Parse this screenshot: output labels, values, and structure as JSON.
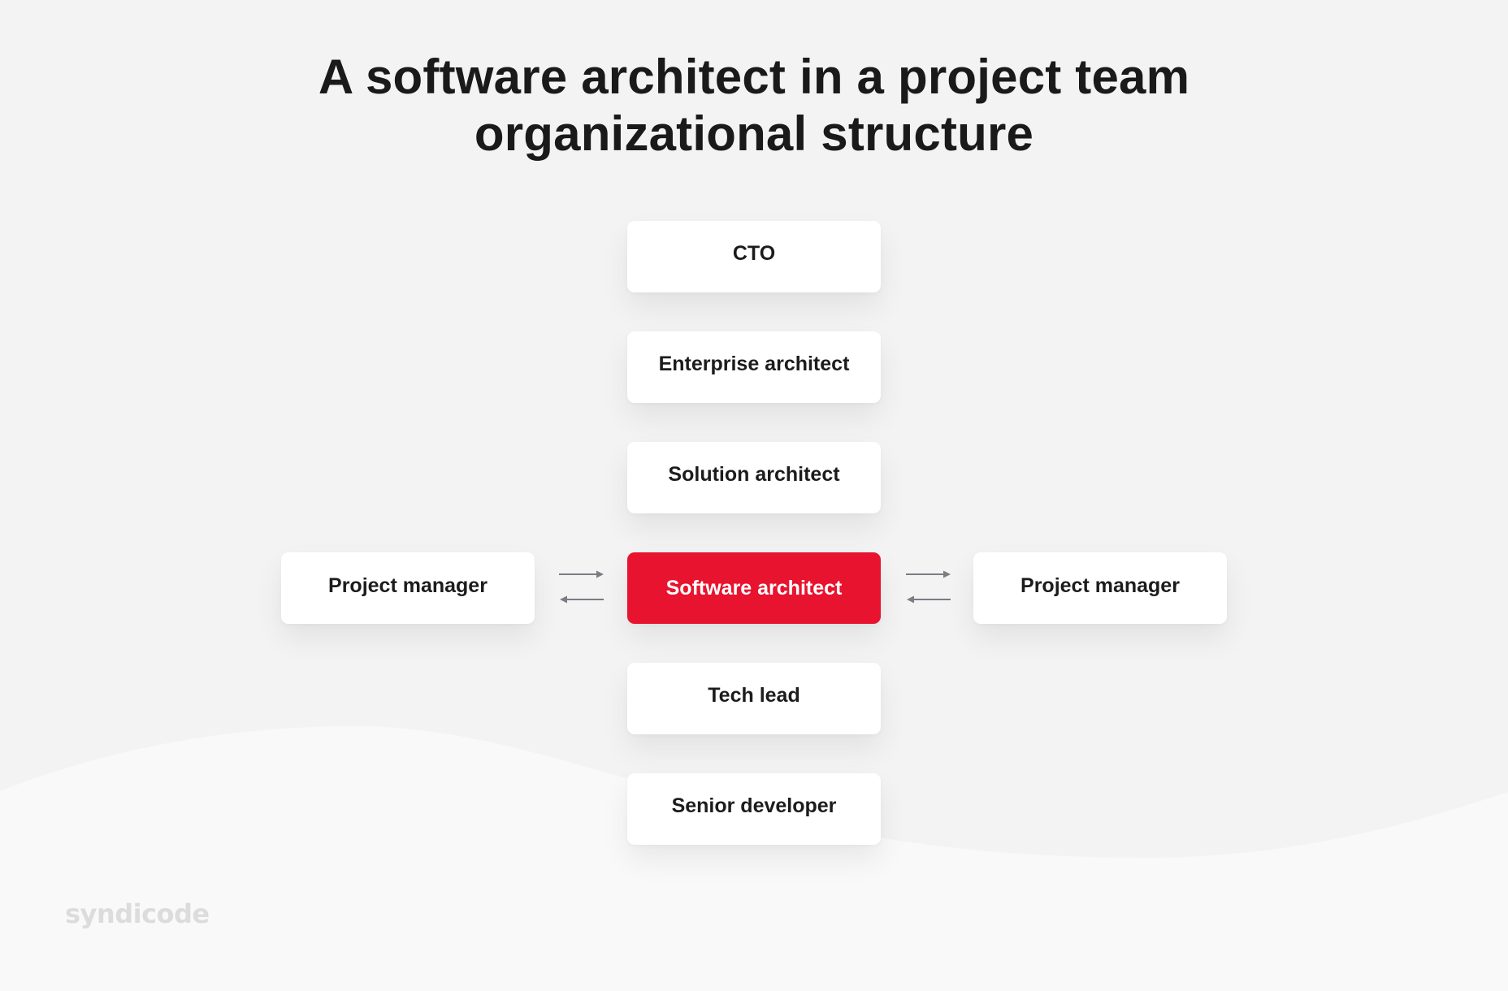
{
  "title": {
    "line1": "A software architect in a project team",
    "line2": "organizational structure"
  },
  "hierarchy": [
    {
      "id": "cto",
      "label": "CTO"
    },
    {
      "id": "enterprise-architect",
      "label": "Enterprise architect"
    },
    {
      "id": "solution-architect",
      "label": "Solution architect"
    },
    {
      "id": "software-architect",
      "label": "Software architect",
      "highlighted": true
    },
    {
      "id": "tech-lead",
      "label": "Tech lead"
    },
    {
      "id": "senior-developer",
      "label": "Senior developer"
    }
  ],
  "side_nodes": {
    "left": {
      "label": "Project manager"
    },
    "right": {
      "label": "Project manager"
    }
  },
  "connectors": {
    "left": {
      "icon": "bidirectional-arrows-icon"
    },
    "right": {
      "icon": "bidirectional-arrows-icon"
    }
  },
  "colors": {
    "highlight": "#e8132e",
    "text": "#1c1c1c",
    "arrow": "#7a7d82",
    "background": "#f3f3f3",
    "wave": "#f9f9f9",
    "logo": "#dcdcdc"
  },
  "logo": {
    "text": "syndicode"
  }
}
